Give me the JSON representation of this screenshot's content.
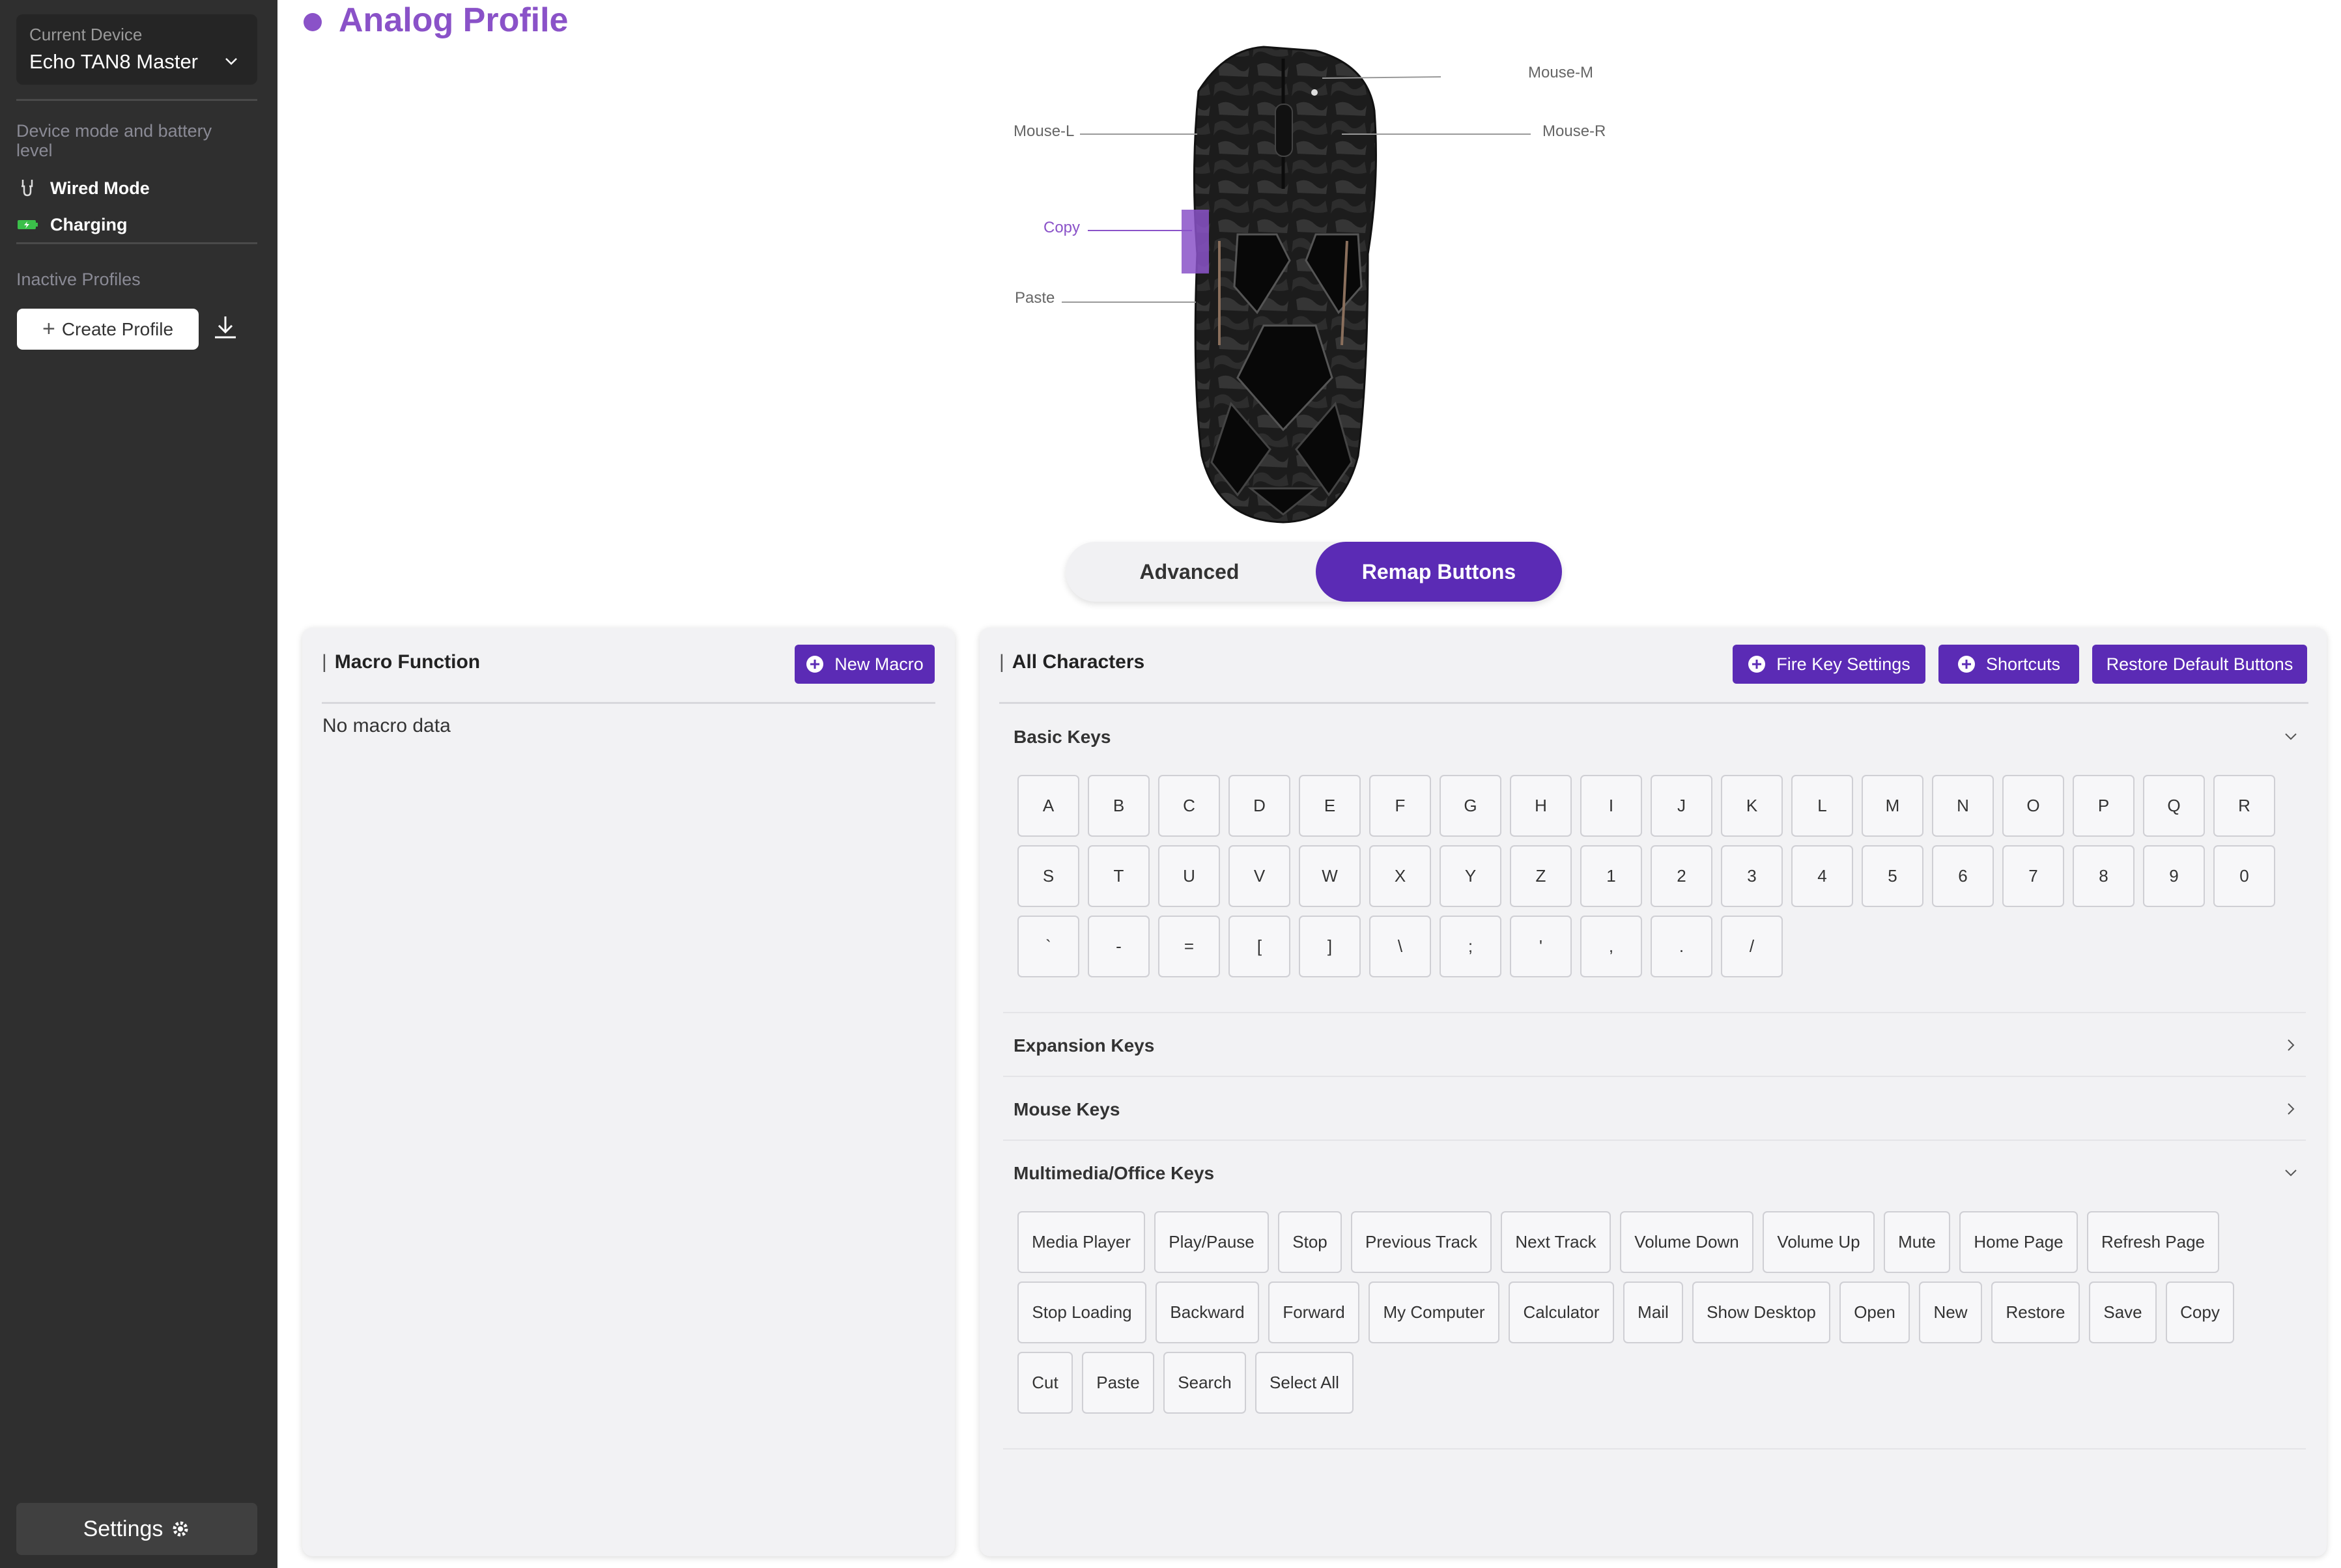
{
  "sidebar": {
    "current_device_label": "Current Device",
    "current_device_value": "Echo TAN8 Master",
    "device_mode_heading": "Device mode and battery level",
    "wired_mode": "Wired Mode",
    "charging": "Charging",
    "inactive_profiles": "Inactive Profiles",
    "create_profile": "Create Profile",
    "settings": "Settings"
  },
  "header": {
    "title": "Analog Profile"
  },
  "mouse": {
    "buttons": {
      "middle": "Mouse-M",
      "left": "Mouse-L",
      "right": "Mouse-R",
      "side_front": "Copy",
      "side_back": "Paste"
    }
  },
  "mode_toggle": {
    "advanced": "Advanced",
    "remap": "Remap Buttons",
    "selected": "Remap Buttons"
  },
  "macro_panel": {
    "title": "Macro Function",
    "new_macro": "New Macro",
    "empty_text": "No macro data"
  },
  "characters_panel": {
    "title": "All Characters",
    "fire_key": "Fire Key Settings",
    "shortcuts": "Shortcuts",
    "restore": "Restore Default Buttons",
    "sections": {
      "basic": "Basic Keys",
      "expansion": "Expansion Keys",
      "mouse": "Mouse Keys",
      "multimedia": "Multimedia/Office Keys"
    },
    "basic_keys": [
      [
        "A",
        "B",
        "C",
        "D",
        "E",
        "F",
        "G",
        "H",
        "I",
        "J",
        "K",
        "L",
        "M",
        "N",
        "O",
        "P",
        "Q",
        "R"
      ],
      [
        "S",
        "T",
        "U",
        "V",
        "W",
        "X",
        "Y",
        "Z",
        "1",
        "2",
        "3",
        "4",
        "5",
        "6",
        "7",
        "8",
        "9",
        "0"
      ],
      [
        "`",
        "-",
        "=",
        "[",
        "]",
        "\\",
        ";",
        "'",
        ",",
        ".",
        "/"
      ]
    ],
    "multimedia_keys": [
      [
        "Media Player",
        "Play/Pause",
        "Stop",
        "Previous Track",
        "Next Track",
        "Volume Down",
        "Volume Up",
        "Mute",
        "Home Page",
        "Refresh Page"
      ],
      [
        "Stop Loading",
        "Backward",
        "Forward",
        "My Computer",
        "Calculator",
        "Mail",
        "Show Desktop",
        "Open",
        "New",
        "Restore",
        "Save",
        "Copy"
      ],
      [
        "Cut",
        "Paste",
        "Search",
        "Select All"
      ]
    ]
  },
  "colors": {
    "accent": "#8a52c8",
    "button": "#5b2bb5",
    "sidebar": "#2f2f2f"
  }
}
